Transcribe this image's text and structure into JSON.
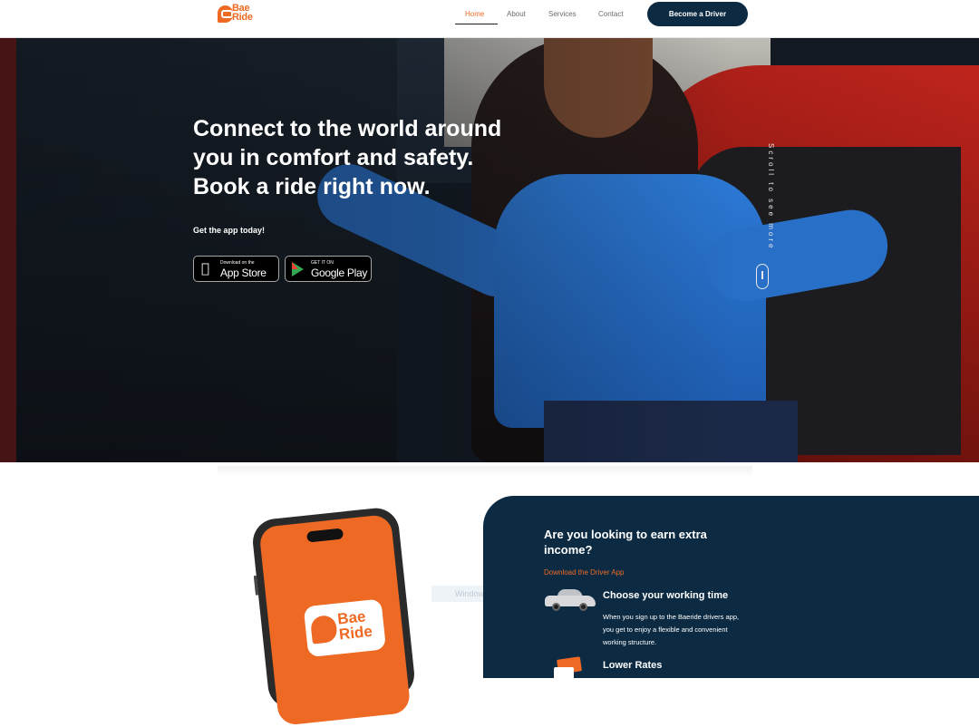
{
  "colors": {
    "brand_orange": "#ee6a24",
    "navy": "#0c2b43"
  },
  "logo": {
    "line1": "Bae",
    "line2": "Ride"
  },
  "nav": {
    "items": [
      {
        "label": "Home",
        "active": true
      },
      {
        "label": "About",
        "active": false
      },
      {
        "label": "Services",
        "active": false
      },
      {
        "label": "Contact",
        "active": false
      }
    ],
    "cta_label": "Become a Driver"
  },
  "hero": {
    "headline": [
      "Connect to the world around",
      "you in comfort and safety.",
      "Book a ride right now."
    ],
    "get_app": "Get the app today!",
    "app_store": {
      "small": "Download on the",
      "big": "App Store",
      "icon": "apple-icon"
    },
    "google_play": {
      "small": "GET IT ON",
      "big": "Google Play",
      "icon": "google-play-icon"
    },
    "scroll_text": "Scroll to see more"
  },
  "phone_logo": {
    "line1": "Bae",
    "line2": "Ride"
  },
  "faded_overlay": "Window Grip",
  "driver": {
    "title": [
      "Are you looking to earn extra",
      "income?"
    ],
    "link": "Download the Driver App",
    "features": [
      {
        "title": "Choose your working time",
        "icon": "car-icon",
        "desc": [
          "When you sign up to the Baeride drivers app,",
          "you get to enjoy a flexible and convenient",
          "working structure."
        ]
      },
      {
        "title": "Lower Rates",
        "icon": "price-tag-icon"
      }
    ]
  }
}
